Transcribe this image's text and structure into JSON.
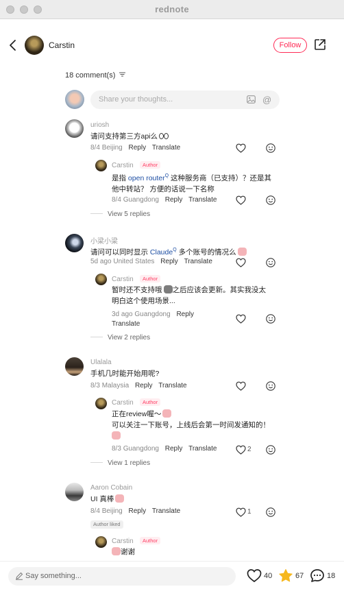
{
  "window": {
    "title": "rednote"
  },
  "header": {
    "author_name": "Carstin",
    "follow_label": "Follow"
  },
  "comments_header": {
    "count_label": "18 comment(s)"
  },
  "composer": {
    "placeholder": "Share your thoughts..."
  },
  "comments": [
    {
      "name": "uriosh",
      "text": "请问支持第三方api么",
      "date": "8/4",
      "location": "Beijing",
      "reply_label": "Reply",
      "translate_label": "Translate",
      "replies": [
        {
          "name": "Carstin",
          "tag": "Author",
          "text_a": "是指 ",
          "link": "open router",
          "text_b": " 这种服务商（已支持）？还是其",
          "text_line2": "他中转站？ 方便的话说一下名称",
          "date": "8/4",
          "location": "Guangdong",
          "reply_label": "Reply",
          "translate_label": "Translate"
        }
      ],
      "view_replies": "View 5 replies"
    },
    {
      "name": "小梁小梁",
      "text_a": "请问可以同时显示 ",
      "link": "Claude",
      "text_b": " 多个账号的情况么",
      "date": "5d ago",
      "location": "United States",
      "reply_label": "Reply",
      "translate_label": "Translate",
      "replies": [
        {
          "name": "Carstin",
          "tag": "Author",
          "text_line1": "暂时还不支持哦",
          "text_line1b": "之后应该会更新。其实我没太",
          "text_line2": "明白这个使用场景...",
          "date": "3d ago",
          "location": "Guangdong",
          "reply_label": "Reply",
          "translate_label": "Translate"
        }
      ],
      "view_replies": "View 2 replies"
    },
    {
      "name": "Ulalala",
      "text": "手机几时能开始用呢?",
      "date": "8/3",
      "location": "Malaysia",
      "reply_label": "Reply",
      "translate_label": "Translate",
      "replies": [
        {
          "name": "Carstin",
          "tag": "Author",
          "text_line1": "正在review喔～",
          "text_line2": "可以关注一下账号，上线后会第一时间发通知的！",
          "date": "8/3",
          "location": "Guangdong",
          "reply_label": "Reply",
          "translate_label": "Translate",
          "likes": "2"
        }
      ],
      "view_replies": "View 1 replies"
    },
    {
      "name": "Aaron Cobain",
      "text": "UI 真棒",
      "date": "8/4",
      "location": "Beijing",
      "reply_label": "Reply",
      "translate_label": "Translate",
      "likes": "1",
      "liked_tag": "Author liked",
      "replies": [
        {
          "name": "Carstin",
          "tag": "Author",
          "text": "谢谢"
        }
      ]
    }
  ],
  "bottom_bar": {
    "placeholder": "Say something...",
    "likes": "40",
    "collects": "67",
    "comments": "18"
  }
}
